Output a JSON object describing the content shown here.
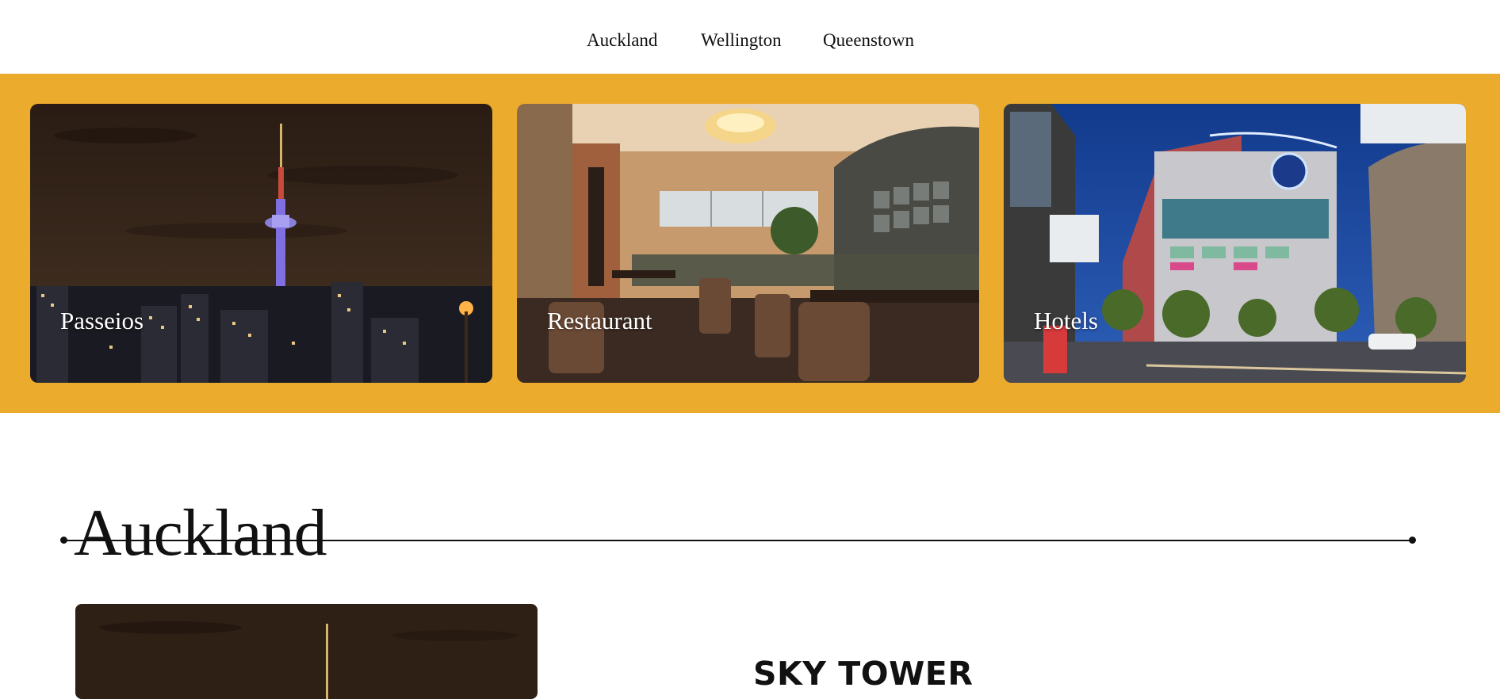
{
  "nav": {
    "items": [
      {
        "label": "Auckland"
      },
      {
        "label": "Wellington"
      },
      {
        "label": "Queenstown"
      }
    ]
  },
  "colors": {
    "band": "#ebab2c",
    "text": "#111111",
    "card_label": "#ffffff"
  },
  "cards": [
    {
      "label": "Passeios",
      "image": "auckland-night-skyline-photo"
    },
    {
      "label": "Restaurant",
      "image": "restaurant-interior-photo"
    },
    {
      "label": "Hotels",
      "image": "skycity-hotel-street-photo"
    }
  ],
  "section": {
    "title": "Auckland"
  },
  "feature": {
    "title": "SKY TOWER",
    "image": "sky-tower-night-photo"
  }
}
